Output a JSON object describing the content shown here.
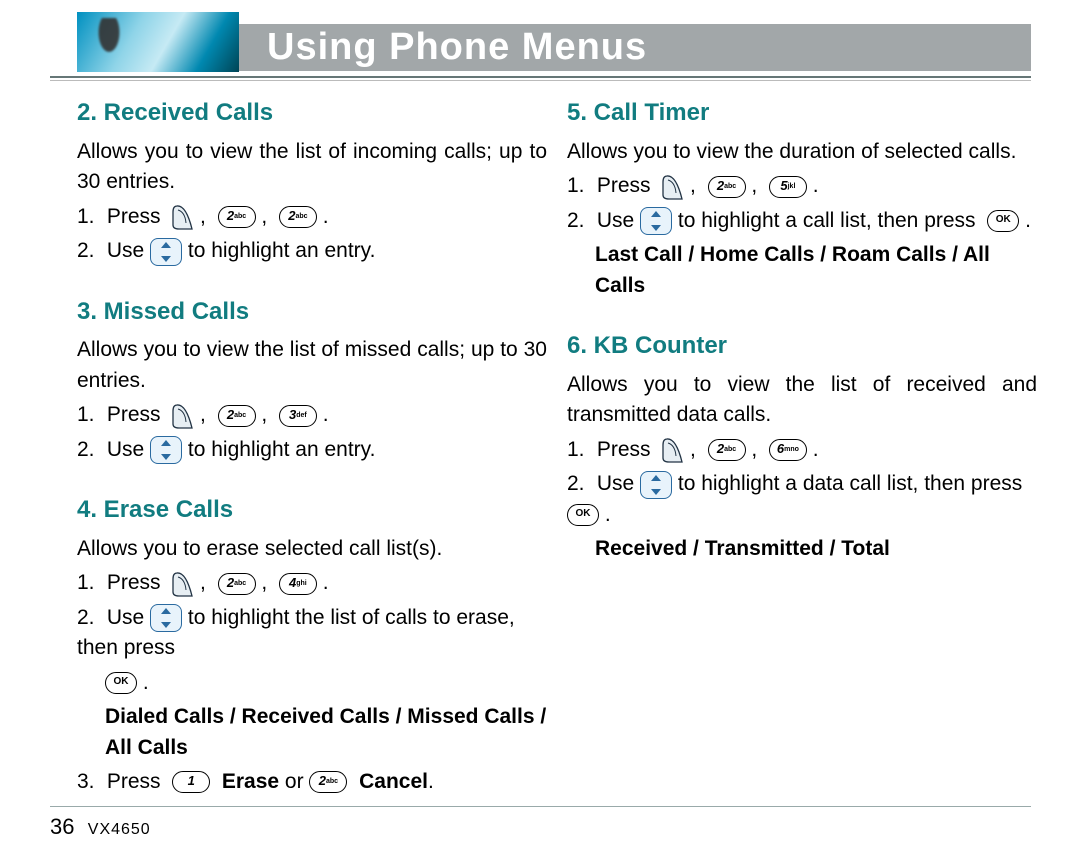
{
  "header": {
    "title": "Using Phone Menus"
  },
  "footer": {
    "page": "36",
    "model": "VX4650"
  },
  "keys": {
    "k1": {
      "num": "1",
      "sub": ""
    },
    "k2": {
      "num": "2",
      "sub": "abc"
    },
    "k3": {
      "num": "3",
      "sub": "def"
    },
    "k4": {
      "num": "4",
      "sub": "ghi"
    },
    "k5": {
      "num": "5",
      "sub": "jkl"
    },
    "k6": {
      "num": "6",
      "sub": "mno"
    },
    "ok": "OK"
  },
  "left": {
    "s2": {
      "title": "2. Received Calls",
      "desc": "Allows you to view the list of incoming calls; up to 30 entries.",
      "step1a": "Press",
      "step2a": "Use",
      "step2b": "to highlight an entry."
    },
    "s3": {
      "title": "3. Missed Calls",
      "desc": "Allows you to view the list of missed calls; up to 30 entries.",
      "step1a": "Press",
      "step2a": "Use",
      "step2b": "to highlight an entry."
    },
    "s4": {
      "title": "4. Erase Calls",
      "desc": "Allows you to erase selected call list(s).",
      "step1a": "Press",
      "step2a": "Use",
      "step2b": "to highlight the list of calls to erase, then press",
      "options": "Dialed Calls / Received Calls / Missed Calls / All Calls",
      "step3a": "Press",
      "step3erase": "Erase",
      "step3or": " or ",
      "step3cancel": "Cancel"
    }
  },
  "right": {
    "s5": {
      "title": "5. Call Timer",
      "desc": "Allows you to view the duration of selected calls.",
      "step1a": "Press",
      "step2a": "Use",
      "step2b": "to highlight a call list, then press",
      "options": "Last Call / Home Calls / Roam Calls / All Calls"
    },
    "s6": {
      "title": "6. KB Counter",
      "desc": "Allows you to view the list of received and transmitted data calls.",
      "step1a": "Press",
      "step2a": "Use",
      "step2b": "to highlight a data call list, then press",
      "options": "Received / Transmitted / Total"
    }
  }
}
